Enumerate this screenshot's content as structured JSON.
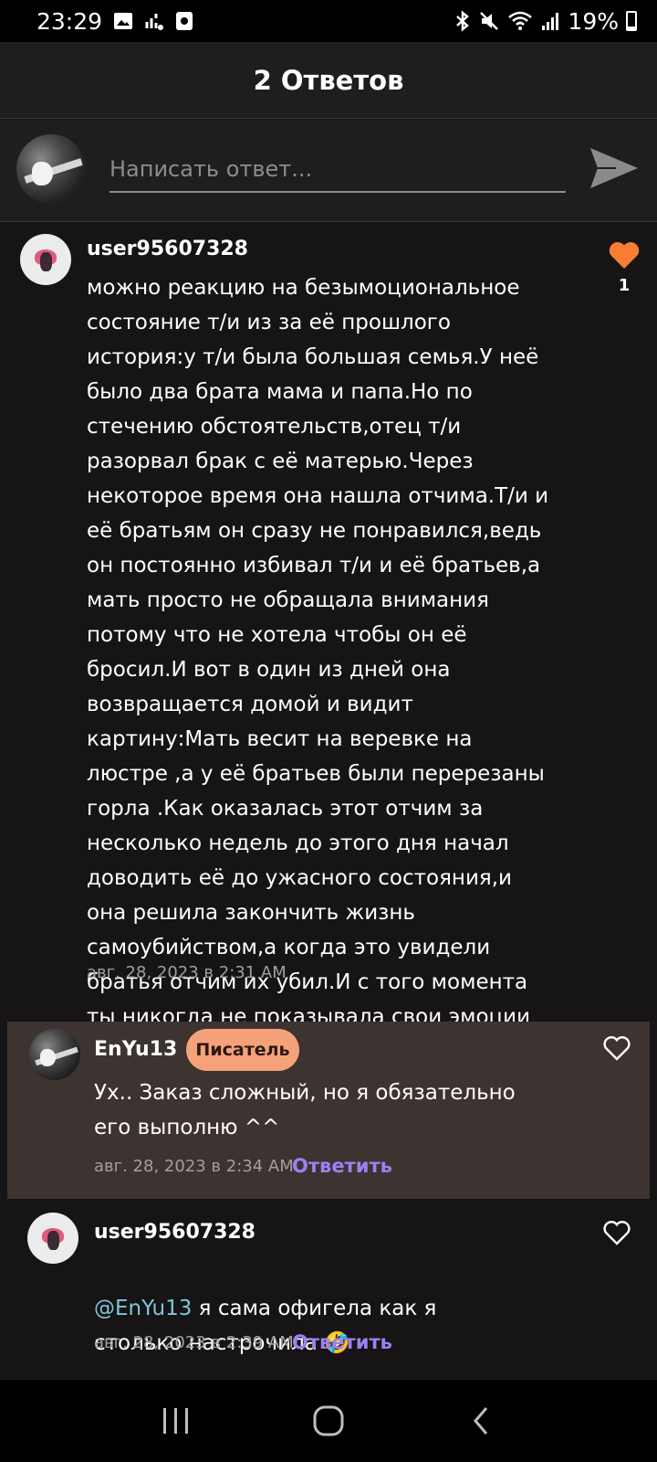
{
  "status_bar": {
    "time": "23:29",
    "battery_percent": "19%",
    "left_icons": [
      "image-icon",
      "signal-activity-icon",
      "screen-record-icon"
    ],
    "right_icons": [
      "bluetooth-icon",
      "mute-icon",
      "wifi-icon",
      "cell-signal-icon",
      "battery-icon"
    ]
  },
  "header": {
    "title": "2 Ответов"
  },
  "reply_box": {
    "placeholder": "Написать ответ..."
  },
  "comments": [
    {
      "username": "user95607328",
      "text": "можно реакцию на безымоциональное состояние т/и из за её прошлого\nистория:у т/и была большая семья.У неё было два брата мама и папа.Но по стечению обстоятельств,отец т/и разорвал брак с её матерью.Через некоторое время она нашла отчима.Т/и и её братьям он сразу не понравился,ведь он постоянно избивал т/и и её братьев,а мать просто не обращала внимания потому что не хотела чтобы он её бросил.И вот в один из дней она возвращается домой и видит картину:Мать весит на веревке на люстре ,а у её братьев были перерезаны горла .Как оказалась этот отчим за несколько недель до этого дня начал доводить её до ужасного состояния,и она решила закончить жизнь самоубийством,а когда это увидели братья отчим их убил.И с того момента ты никогда не показывала свои эмоции",
      "timestamp": "авг. 28, 2023 в 2:31 AM",
      "likes": "1",
      "liked": true
    },
    {
      "username": "EnYu13",
      "badge": "Писатель",
      "text": "Ух.. Заказ сложный, но я обязательно его выполню ^^",
      "timestamp": "авг. 28, 2023 в 2:34 AM",
      "reply_label": "Ответить",
      "liked": false
    },
    {
      "username": "user95607328",
      "mention": "@EnYu13",
      "text": " я сама офигела как я столько настрочила 🤣",
      "timestamp": "авг. 28, 2023 в 2:39 AM",
      "reply_label": "Ответить",
      "liked": false
    }
  ],
  "nav": {
    "buttons": [
      "recent-apps-icon",
      "home-icon",
      "back-icon"
    ]
  },
  "colors": {
    "background": "#161415",
    "header": "#1f1e1f",
    "highlight_bg": "#3d3330",
    "accent_heart": "#f77d32",
    "badge": "#f5a27b",
    "reply_link": "#9a82f0",
    "mention": "#7fc7d8"
  }
}
